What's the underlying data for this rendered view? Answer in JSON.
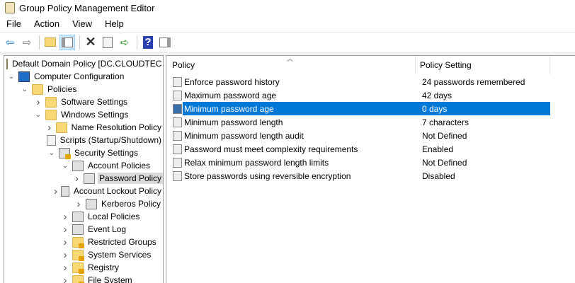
{
  "window": {
    "title": "Group Policy Management Editor"
  },
  "menu": [
    "File",
    "Action",
    "View",
    "Help"
  ],
  "toolbar": [
    "back-icon",
    "forward-icon",
    "up-folder-icon",
    "show-hide-tree-icon",
    "delete-icon",
    "properties-icon",
    "export-list-icon",
    "help-icon",
    "show-action-pane-icon"
  ],
  "tree": [
    {
      "label": "Default Domain Policy [DC.CLOUDTEC",
      "level": 0,
      "chev": "",
      "icon": "scroll"
    },
    {
      "label": "Computer Configuration",
      "level": 1,
      "chev": "down",
      "icon": "pc"
    },
    {
      "label": "Policies",
      "level": 2,
      "chev": "down",
      "icon": "folder"
    },
    {
      "label": "Software Settings",
      "level": 3,
      "chev": "right",
      "icon": "folder"
    },
    {
      "label": "Windows Settings",
      "level": 3,
      "chev": "down",
      "icon": "folder"
    },
    {
      "label": "Name Resolution Policy",
      "level": 4,
      "chev": "right",
      "icon": "folder"
    },
    {
      "label": "Scripts (Startup/Shutdown)",
      "level": 4,
      "chev": "",
      "icon": "doc"
    },
    {
      "label": "Security Settings",
      "level": 4,
      "chev": "down",
      "icon": "server lock"
    },
    {
      "label": "Account Policies",
      "level": 5,
      "chev": "down",
      "icon": "server"
    },
    {
      "label": "Password Policy",
      "level": 6,
      "chev": "right",
      "icon": "server",
      "selected": true
    },
    {
      "label": "Account Lockout Policy",
      "level": 6,
      "chev": "right",
      "icon": "server"
    },
    {
      "label": "Kerberos Policy",
      "level": 6,
      "chev": "right",
      "icon": "server"
    },
    {
      "label": "Local Policies",
      "level": 5,
      "chev": "right",
      "icon": "server"
    },
    {
      "label": "Event Log",
      "level": 5,
      "chev": "right",
      "icon": "server"
    },
    {
      "label": "Restricted Groups",
      "level": 5,
      "chev": "right",
      "icon": "folder lock"
    },
    {
      "label": "System Services",
      "level": 5,
      "chev": "right",
      "icon": "folder lock"
    },
    {
      "label": "Registry",
      "level": 5,
      "chev": "right",
      "icon": "folder lock"
    },
    {
      "label": "File System",
      "level": 5,
      "chev": "right",
      "icon": "folder lock"
    }
  ],
  "list": {
    "columns": [
      "Policy",
      "Policy Setting"
    ],
    "rows": [
      {
        "policy": "Enforce password history",
        "setting": "24 passwords remembered"
      },
      {
        "policy": "Maximum password age",
        "setting": "42 days"
      },
      {
        "policy": "Minimum password age",
        "setting": "0 days",
        "selected": true
      },
      {
        "policy": "Minimum password length",
        "setting": "7 characters"
      },
      {
        "policy": "Minimum password length audit",
        "setting": "Not Defined"
      },
      {
        "policy": "Password must meet complexity requirements",
        "setting": "Enabled"
      },
      {
        "policy": "Relax minimum password length limits",
        "setting": "Not Defined"
      },
      {
        "policy": "Store passwords using reversible encryption",
        "setting": "Disabled"
      }
    ]
  },
  "colors": {
    "selection": "#0078d7",
    "tree_selection": "#d9d9d9"
  }
}
